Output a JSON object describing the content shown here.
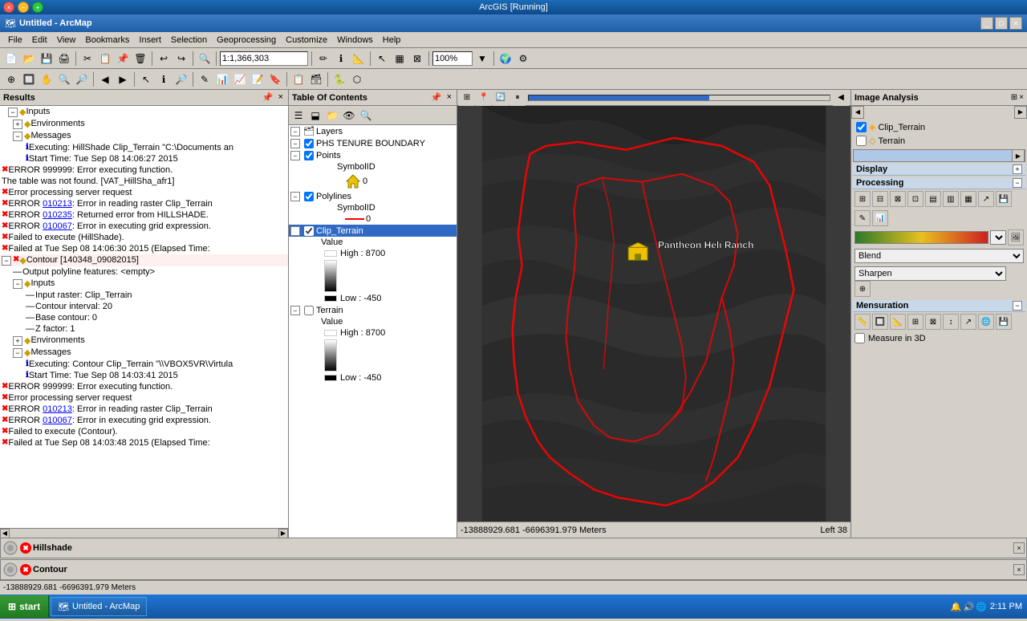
{
  "window": {
    "os_title": "ArcGIS [Running]",
    "app_title": "Untitled - ArcMap",
    "app_icon": "🗺"
  },
  "menu": {
    "items": [
      "File",
      "Edit",
      "View",
      "Bookmarks",
      "Insert",
      "Selection",
      "Geoprocessing",
      "Customize",
      "Windows",
      "Help"
    ]
  },
  "toolbar": {
    "scale": "1:1,366,303",
    "zoom_percent": "100%"
  },
  "results_panel": {
    "title": "Results",
    "items": [
      {
        "type": "expand",
        "label": "Inputs",
        "indent": 0
      },
      {
        "type": "expand",
        "label": "Environments",
        "indent": 0
      },
      {
        "type": "expand",
        "label": "Messages",
        "indent": 0
      },
      {
        "type": "info",
        "label": "Executing: HillShade Clip_Terrain \"C:\\Documents an",
        "indent": 1
      },
      {
        "type": "info",
        "label": "Start Time: Tue Sep 08 14:06:27 2015",
        "indent": 1
      },
      {
        "type": "error",
        "label": "ERROR 999999: Error executing function.",
        "indent": 1
      },
      {
        "type": "plain",
        "label": "The table was not found. [VAT_HillSha_afr1]",
        "indent": 1
      },
      {
        "type": "error",
        "label": "Error processing server request",
        "indent": 1
      },
      {
        "type": "error",
        "label": "ERROR 010213: Error in reading raster Clip_Terrain",
        "indent": 1,
        "link": "010213"
      },
      {
        "type": "error",
        "label": "ERROR 010235: Returned error from HILLSHADE.",
        "indent": 1,
        "link": "010235"
      },
      {
        "type": "error",
        "label": "ERROR 010067: Error in executing grid expression.",
        "indent": 1,
        "link": "010067"
      },
      {
        "type": "error",
        "label": "Failed to execute (HillShade).",
        "indent": 1
      },
      {
        "type": "error",
        "label": "Failed at Tue Sep 08 14:06:30 2015 (Elapsed Time:",
        "indent": 1
      },
      {
        "type": "expand_error",
        "label": "Contour [140348_09082015]",
        "indent": 0
      },
      {
        "type": "plain",
        "label": "Output polyline features: <empty>",
        "indent": 1
      },
      {
        "type": "expand",
        "label": "Inputs",
        "indent": 1
      },
      {
        "type": "plain",
        "label": "Input raster: Clip_Terrain",
        "indent": 2
      },
      {
        "type": "plain",
        "label": "Contour interval: 20",
        "indent": 2
      },
      {
        "type": "plain",
        "label": "Base contour: 0",
        "indent": 2
      },
      {
        "type": "plain",
        "label": "Z factor: 1",
        "indent": 2
      },
      {
        "type": "expand",
        "label": "Environments",
        "indent": 1
      },
      {
        "type": "expand",
        "label": "Messages",
        "indent": 1
      },
      {
        "type": "info",
        "label": "Executing: Contour Clip_Terrain \"\\\\VBOX5VR\\Virtula",
        "indent": 2
      },
      {
        "type": "info",
        "label": "Start Time: Tue Sep 08 14:03:41 2015",
        "indent": 2
      },
      {
        "type": "error",
        "label": "ERROR 999999: Error executing function.",
        "indent": 2
      },
      {
        "type": "error",
        "label": "Error processing server request",
        "indent": 2
      },
      {
        "type": "error",
        "label": "ERROR 010213: Error in reading raster Clip_Terrain",
        "indent": 2,
        "link": "010213"
      },
      {
        "type": "error",
        "label": "ERROR 010067: Error in executing grid expression.",
        "indent": 2,
        "link": "010067"
      },
      {
        "type": "error",
        "label": "Failed to execute (Contour).",
        "indent": 2
      },
      {
        "type": "error",
        "label": "Failed at Tue Sep 08 14:03:48 2015 (Elapsed Time:",
        "indent": 2
      }
    ]
  },
  "toc": {
    "title": "Table Of Contents",
    "layers": [
      {
        "name": "Layers",
        "type": "group",
        "checked": false,
        "expanded": true
      },
      {
        "name": "PHS TENURE BOUNDARY",
        "type": "layer",
        "checked": true,
        "indent": 1
      },
      {
        "name": "Points",
        "type": "sublayer",
        "checked": true,
        "indent": 2
      },
      {
        "name": "SymbolID",
        "type": "field",
        "indent": 3
      },
      {
        "name": "0",
        "type": "value",
        "indent": 4,
        "symbol": "house"
      },
      {
        "name": "Polylines",
        "type": "sublayer",
        "checked": true,
        "indent": 2
      },
      {
        "name": "SymbolID",
        "type": "field",
        "indent": 3
      },
      {
        "name": "0",
        "type": "value",
        "indent": 4,
        "symbol": "line"
      },
      {
        "name": "Clip_Terrain",
        "type": "raster",
        "checked": true,
        "indent": 1,
        "selected": true
      },
      {
        "name": "Value",
        "type": "field",
        "indent": 2
      },
      {
        "name": "High : 8700",
        "type": "value",
        "indent": 3
      },
      {
        "name": "Low : -450",
        "type": "value",
        "indent": 3
      },
      {
        "name": "Terrain",
        "type": "raster",
        "checked": false,
        "indent": 1
      },
      {
        "name": "Value",
        "type": "field",
        "indent": 2
      },
      {
        "name": "High : 8700",
        "type": "value",
        "indent": 3
      },
      {
        "name": "Low : -450",
        "type": "value",
        "indent": 3
      }
    ]
  },
  "image_analysis": {
    "title": "Image Analysis",
    "layers": [
      {
        "name": "Clip_Terrain",
        "checked": true,
        "icon": "raster"
      },
      {
        "name": "Terrain",
        "checked": false,
        "icon": "diamond"
      }
    ],
    "sections": {
      "display": "Display",
      "processing": "Processing",
      "mensuration": "Mensuration"
    },
    "blend": "Blend",
    "sharpen": "Sharpen",
    "measure_in_3d": "Measure in 3D"
  },
  "map": {
    "location_label": "Pantheon Heli Ranch",
    "coordinates": "-13888929.681 -6696391.979 Meters",
    "zoom_level": "Left 38"
  },
  "floating_panels": [
    {
      "title": "Hillshade",
      "icon": "⚙"
    },
    {
      "title": "Contour",
      "icon": "⚙"
    }
  ],
  "taskbar": {
    "start_label": "start",
    "active_window": "Untitled - ArcMap",
    "time": "2:11 PM"
  },
  "status_bar": {
    "coordinates": "-13888929.681 -6696391.979 Meters",
    "zoom": "Left 38"
  }
}
